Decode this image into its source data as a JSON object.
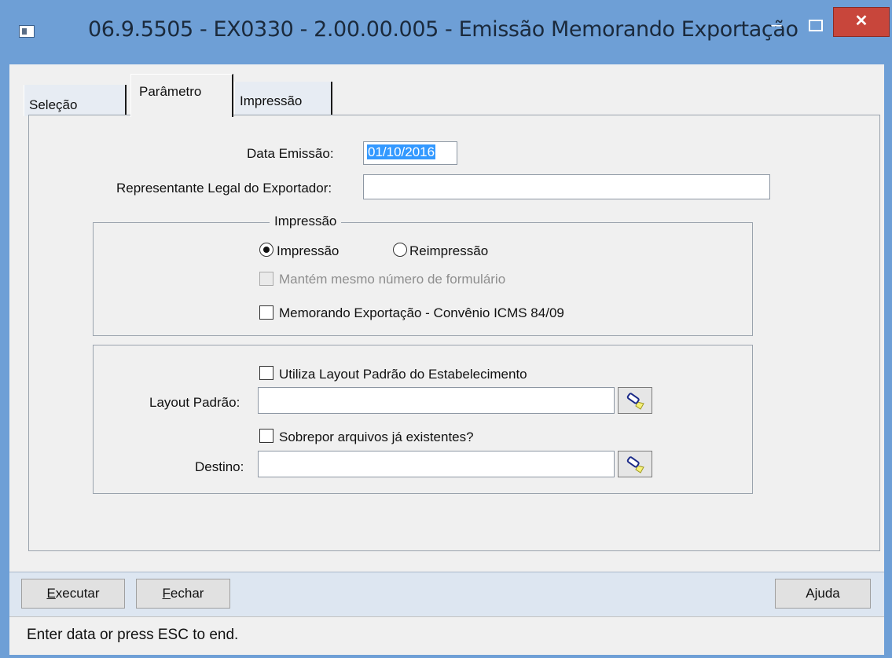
{
  "window": {
    "title": "06.9.5505 - EX0330 - 2.00.00.005 - Emissão Memorando Exportação",
    "minimize_glyph": "–",
    "close_glyph": "✕"
  },
  "tabs": [
    {
      "label": "Seleção",
      "active": false
    },
    {
      "label": "Parâmetro",
      "active": true
    },
    {
      "label": "Impressão",
      "active": false
    }
  ],
  "form": {
    "data_emissao_label": "Data Emissão:",
    "data_emissao_value": "01/10/2016",
    "representante_label": "Representante Legal do Exportador:",
    "representante_value": ""
  },
  "impressao_group": {
    "title": "Impressão",
    "radio_impressao_label": "Impressão",
    "radio_reimpressao_label": "Reimpressão",
    "selected": "Impressão",
    "mantem_label": "Mantém mesmo número de formulário",
    "mantem_checked": false,
    "mantem_enabled": false,
    "convenio_label": "Memorando Exportação - Convênio ICMS 84/09",
    "convenio_checked": false
  },
  "layout_group": {
    "utiliza_label": "Utiliza Layout Padrão do Estabelecimento",
    "utiliza_checked": false,
    "layout_label": "Layout Padrão:",
    "layout_value": "",
    "sobrepor_label": "Sobrepor arquivos já existentes?",
    "sobrepor_checked": false,
    "destino_label": "Destino:",
    "destino_value": ""
  },
  "buttons": {
    "executar_hotkey": "E",
    "executar_rest": "xecutar",
    "fechar_hotkey": "F",
    "fechar_rest": "echar",
    "ajuda_pre": "A",
    "ajuda_hotkey": "j",
    "ajuda_rest": "uda"
  },
  "status": {
    "message": "Enter data or press ESC to end."
  },
  "colors": {
    "titlebar": "#6e9fd6",
    "close_button": "#c8463b",
    "selection": "#3399ff"
  }
}
